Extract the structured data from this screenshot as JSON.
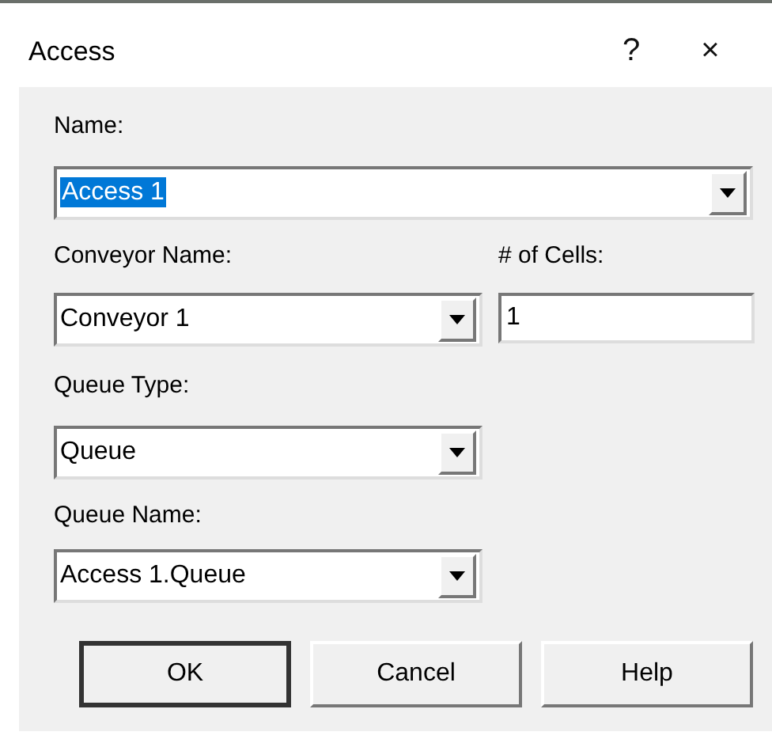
{
  "window": {
    "title": "Access",
    "help_glyph": "?",
    "close_glyph": "×"
  },
  "name": {
    "label": "Name:",
    "value": "Access 1",
    "text_selected": true
  },
  "conveyor": {
    "label": "Conveyor Name:",
    "value": "Conveyor 1"
  },
  "cells": {
    "label": "# of Cells:",
    "value": "1"
  },
  "queue_type": {
    "label": "Queue Type:",
    "value": "Queue"
  },
  "queue_name": {
    "label": "Queue Name:",
    "value": "Access 1.Queue"
  },
  "buttons": [
    {
      "label": "OK",
      "default": true
    },
    {
      "label": "Cancel",
      "default": false
    },
    {
      "label": "Help",
      "default": false
    }
  ]
}
